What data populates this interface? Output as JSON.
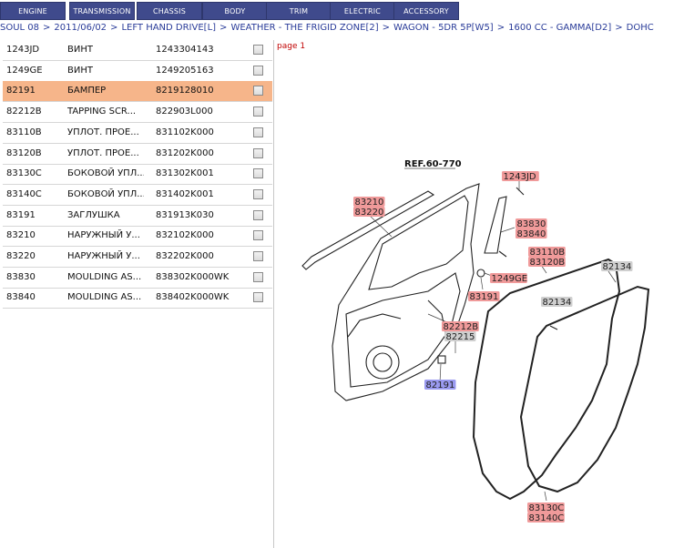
{
  "nav": {
    "tabs": [
      "ENGINE",
      "TRANSMISSION",
      "CHASSIS",
      "BODY",
      "TRIM",
      "ELECTRIC",
      "ACCESSORY"
    ]
  },
  "breadcrumb": [
    "SOUL 08",
    "2011/06/02",
    "LEFT HAND DRIVE[L]",
    "WEATHER - THE FRIGID ZONE[2]",
    "WAGON - 5DR 5P[W5]",
    "1600 CC - GAMMA[D2]",
    "DOHC"
  ],
  "breadcrumb_sep": ">",
  "parts": [
    {
      "code": "1243JD",
      "name": "ВИНТ",
      "number": "1243304143"
    },
    {
      "code": "1249GE",
      "name": "ВИНТ",
      "number": "1249205163"
    },
    {
      "code": "82191",
      "name": "БАМПЕР",
      "number": "8219128010"
    },
    {
      "code": "82212B",
      "name": "TAPPING SCR...",
      "number": "822903L000"
    },
    {
      "code": "83110B",
      "name": "УПЛОТ. ПРОЕ...",
      "number": "831102K000"
    },
    {
      "code": "83120B",
      "name": "УПЛОТ. ПРОЕ...",
      "number": "831202K000"
    },
    {
      "code": "83130C",
      "name": "БОКОВОЙ УПЛ...",
      "number": "831302K001"
    },
    {
      "code": "83140C",
      "name": "БОКОВОЙ УПЛ...",
      "number": "831402K001"
    },
    {
      "code": "83191",
      "name": "ЗАГЛУШКА",
      "number": "831913K030"
    },
    {
      "code": "83210",
      "name": "НАРУЖНЫЙ У...",
      "number": "832102K000"
    },
    {
      "code": "83220",
      "name": "НАРУЖНЫЙ У...",
      "number": "832202K000"
    },
    {
      "code": "83830",
      "name": "MOULDING AS...",
      "number": "838302K000WK"
    },
    {
      "code": "83840",
      "name": "MOULDING AS...",
      "number": "838402K000WK"
    }
  ],
  "selected_part": "82191",
  "page_label": "page 1",
  "diagram": {
    "ref": "REF.60-770",
    "labels": {
      "l_1243jd": "1243JD",
      "l_83210": "83210",
      "l_83220": "83220",
      "l_83830": "83830",
      "l_83840": "83840",
      "l_83110b": "83110B",
      "l_83120b": "83120B",
      "l_82134a": "82134",
      "l_82134b": "82134",
      "l_1249ge": "1249GE",
      "l_83191": "83191",
      "l_82212b": "82212B",
      "l_82215": "82215",
      "l_82191": "82191",
      "l_83130c": "83130C",
      "l_83140c": "83140C"
    }
  },
  "colors": {
    "tab_bg": "#3f4a8c",
    "selected_row": "#f6b58a",
    "label_red": "#f09a9a",
    "label_gray": "#cfcfcf",
    "label_blue": "#9a9af0"
  }
}
